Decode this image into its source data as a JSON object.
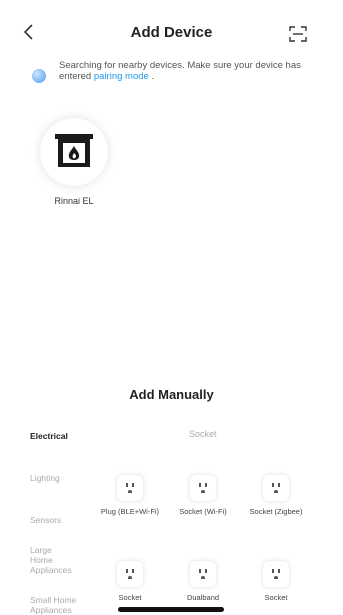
{
  "header": {
    "title": "Add Device",
    "back_icon": "chevron-left-icon",
    "scan_icon": "scan-icon"
  },
  "notice": {
    "text": "Searching for nearby devices. Make sure your device has entered",
    "link": "pairing mode",
    "suffix": "."
  },
  "discovered": [
    {
      "name": "Rinnai EL",
      "icon": "fireplace-icon"
    }
  ],
  "manual": {
    "title": "Add Manually",
    "section_label": "Socket",
    "categories": [
      "Electrical",
      "Lighting",
      "Sensors",
      "Large Home Appliances",
      "Small Home Appliances"
    ],
    "active_category": "Electrical",
    "tiles": [
      {
        "label": "Plug (BLE+Wi-Fi)",
        "icon": "socket-icon"
      },
      {
        "label": "Socket (Wi-Fi)",
        "icon": "socket-icon"
      },
      {
        "label": "Socket (Zigbee)",
        "icon": "socket-icon"
      },
      {
        "label": "Socket",
        "icon": "socket-icon"
      },
      {
        "label": "Dualband",
        "icon": "socket-icon"
      },
      {
        "label": "Socket",
        "icon": "socket-icon"
      }
    ]
  }
}
